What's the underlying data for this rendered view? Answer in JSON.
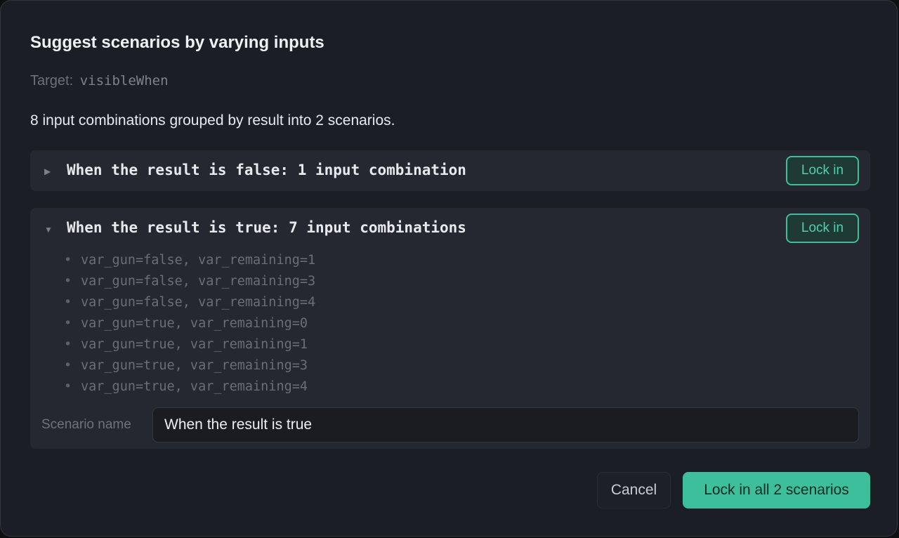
{
  "dialog": {
    "title": "Suggest scenarios by varying inputs",
    "target_label": "Target:",
    "target_value": "visibleWhen",
    "summary": "8 input combinations grouped by result into 2 scenarios."
  },
  "icons": {
    "collapsed": "caret-right-icon",
    "expanded": "caret-down-icon"
  },
  "groups": [
    {
      "caret": "▶",
      "title": "When the result is false: 1 input combination",
      "expanded": false,
      "lock_label": "Lock in"
    },
    {
      "caret": "▼",
      "title": "When the result is true: 7 input combinations",
      "expanded": true,
      "lock_label": "Lock in",
      "combinations": [
        "var_gun=false, var_remaining=1",
        "var_gun=false, var_remaining=3",
        "var_gun=false, var_remaining=4",
        "var_gun=true, var_remaining=0",
        "var_gun=true, var_remaining=1",
        "var_gun=true, var_remaining=3",
        "var_gun=true, var_remaining=4"
      ],
      "bullet": "•",
      "name_label": "Scenario name",
      "name_value": "When the result is true"
    }
  ],
  "footer": {
    "cancel_label": "Cancel",
    "primary_label": "Lock in all 2 scenarios"
  },
  "colors": {
    "accent": "#3dbf9c",
    "background": "#1c1e25",
    "panel": "#252830"
  }
}
